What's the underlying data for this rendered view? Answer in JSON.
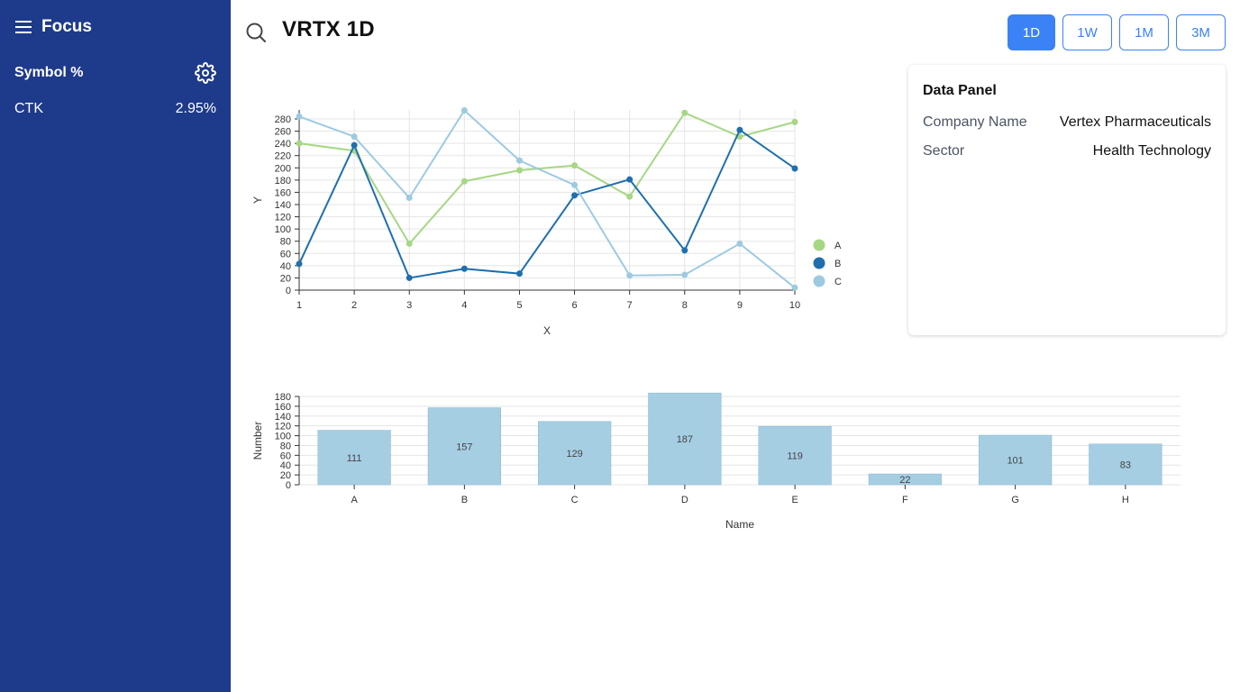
{
  "app": {
    "brand": "Focus",
    "menu_icon": "hamburger-menu-icon"
  },
  "sidebar": {
    "header_label": "Symbol %",
    "settings_icon": "gear-icon",
    "items": [
      {
        "symbol": "CTK",
        "change": "2.95%"
      }
    ]
  },
  "header": {
    "search_icon": "search-icon",
    "title": "VRTX 1D",
    "ranges": [
      "1D",
      "1W",
      "1M",
      "3M"
    ],
    "active_range": "1D"
  },
  "data_panel": {
    "title": "Data Panel",
    "rows": [
      {
        "key": "Company Name",
        "value": "Vertex Pharmaceuticals"
      },
      {
        "key": "Sector",
        "value": "Health Technology"
      }
    ]
  },
  "colors": {
    "sidebar": "#1e3a8a",
    "accent": "#3b82f6",
    "series_a": "#a6d785",
    "series_b": "#1f6fad",
    "series_c": "#9ecae1",
    "bar": "#a6cee3"
  },
  "chart_data": [
    {
      "type": "line",
      "xlabel": "X",
      "ylabel": "Y",
      "x": [
        1,
        2,
        3,
        4,
        5,
        6,
        7,
        8,
        9,
        10
      ],
      "ylim": [
        0,
        280
      ],
      "yticks": [
        0,
        20,
        40,
        60,
        80,
        100,
        120,
        140,
        160,
        180,
        200,
        220,
        240,
        260,
        280
      ],
      "grid": true,
      "legend": "right",
      "series": [
        {
          "name": "A",
          "values": [
            240,
            228,
            76,
            178,
            196,
            204,
            153,
            290,
            251,
            275
          ]
        },
        {
          "name": "B",
          "values": [
            43,
            237,
            20,
            35,
            27,
            155,
            181,
            65,
            262,
            199
          ]
        },
        {
          "name": "C",
          "values": [
            284,
            251,
            151,
            294,
            212,
            172,
            24,
            25,
            76,
            4
          ]
        }
      ]
    },
    {
      "type": "bar",
      "xlabel": "Name",
      "ylabel": "Number",
      "categories": [
        "A",
        "B",
        "C",
        "D",
        "E",
        "F",
        "G",
        "H"
      ],
      "values": [
        111,
        157,
        129,
        187,
        119,
        22,
        101,
        83
      ],
      "ylim": [
        0,
        180
      ],
      "yticks": [
        0,
        20,
        40,
        60,
        80,
        100,
        120,
        140,
        160,
        180
      ],
      "grid": true
    }
  ]
}
